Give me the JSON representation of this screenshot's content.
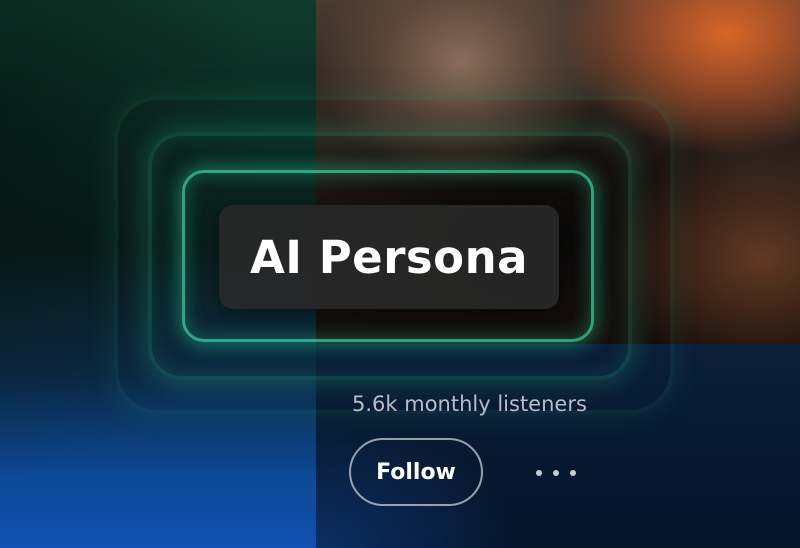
{
  "artist": {
    "name": "AI Persona",
    "monthly_listeners": "5.6k monthly listeners"
  },
  "actions": {
    "follow_label": "Follow",
    "more_icon": "more-horizontal-icon"
  },
  "colors": {
    "accent_glow": "#3cd2a0",
    "pill_background": "#282828",
    "text_primary": "#ffffff",
    "text_secondary": "#b8bcc4"
  }
}
